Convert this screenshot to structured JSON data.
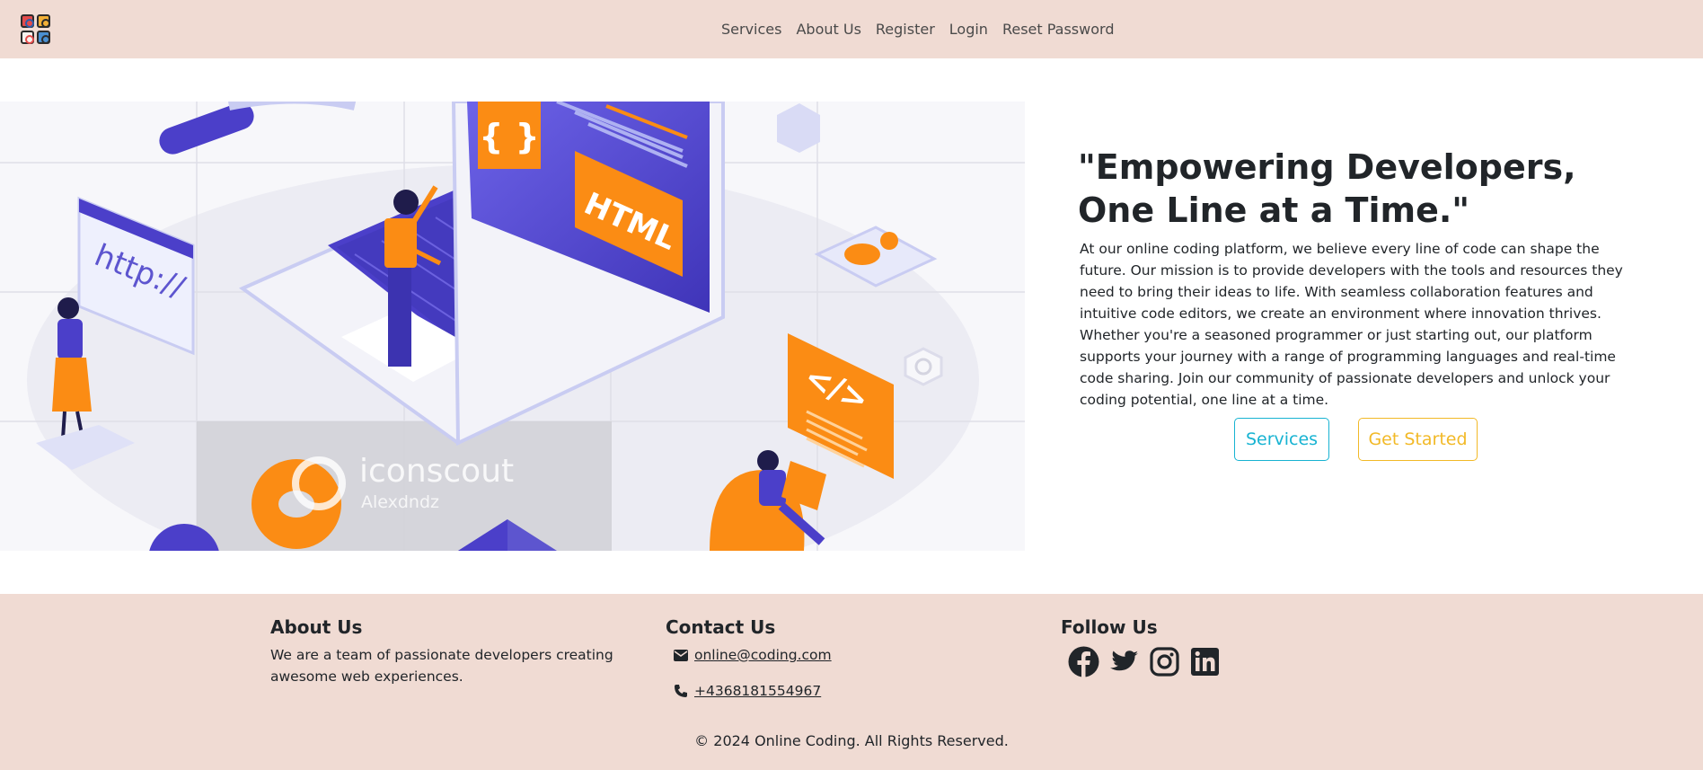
{
  "nav": {
    "logo": "logo-icon",
    "links": [
      "Services",
      "About Us",
      "Register",
      "Login",
      "Reset Password"
    ]
  },
  "hero": {
    "image_text": {
      "http": "http://",
      "braces": "{ }",
      "html": "HTML",
      "code": "</>",
      "watermark": "iconscout",
      "watermark_author": "Alexdndz"
    },
    "title": "\"Empowering Developers, One Line at a Time.\"",
    "text": "At our online coding platform, we believe every line of code can shape the future. Our mission is to provide developers with the tools and resources they need to bring their ideas to life. With seamless collaboration features and intuitive code editors, we create an environment where innovation thrives. Whether you're a seasoned programmer or just starting out, our platform supports your journey with a range of programming languages and real-time code sharing. Join our community of passionate developers and unlock your coding potential, one line at a time.",
    "buttons": {
      "services": "Services",
      "get_started": "Get Started"
    }
  },
  "footer": {
    "about": {
      "heading": "About Us",
      "text": "We are a team of passionate developers creating awesome web experiences."
    },
    "contact": {
      "heading": "Contact Us",
      "email": "online@coding.com",
      "phone": "+4368181554967"
    },
    "follow": {
      "heading": "Follow Us",
      "icons": [
        "facebook-icon",
        "twitter-icon",
        "instagram-icon",
        "linkedin-icon"
      ]
    },
    "copyright": "© 2024 Online Coding. All Rights Reserved."
  },
  "colors": {
    "nav_bg": "#f0dbd3",
    "footer_bg": "#f0dbd3",
    "services_button": "#17b3d2",
    "get_started_button": "#f2b927",
    "illustration_purple": "#4b3fc9",
    "illustration_orange": "#fb8c14"
  }
}
